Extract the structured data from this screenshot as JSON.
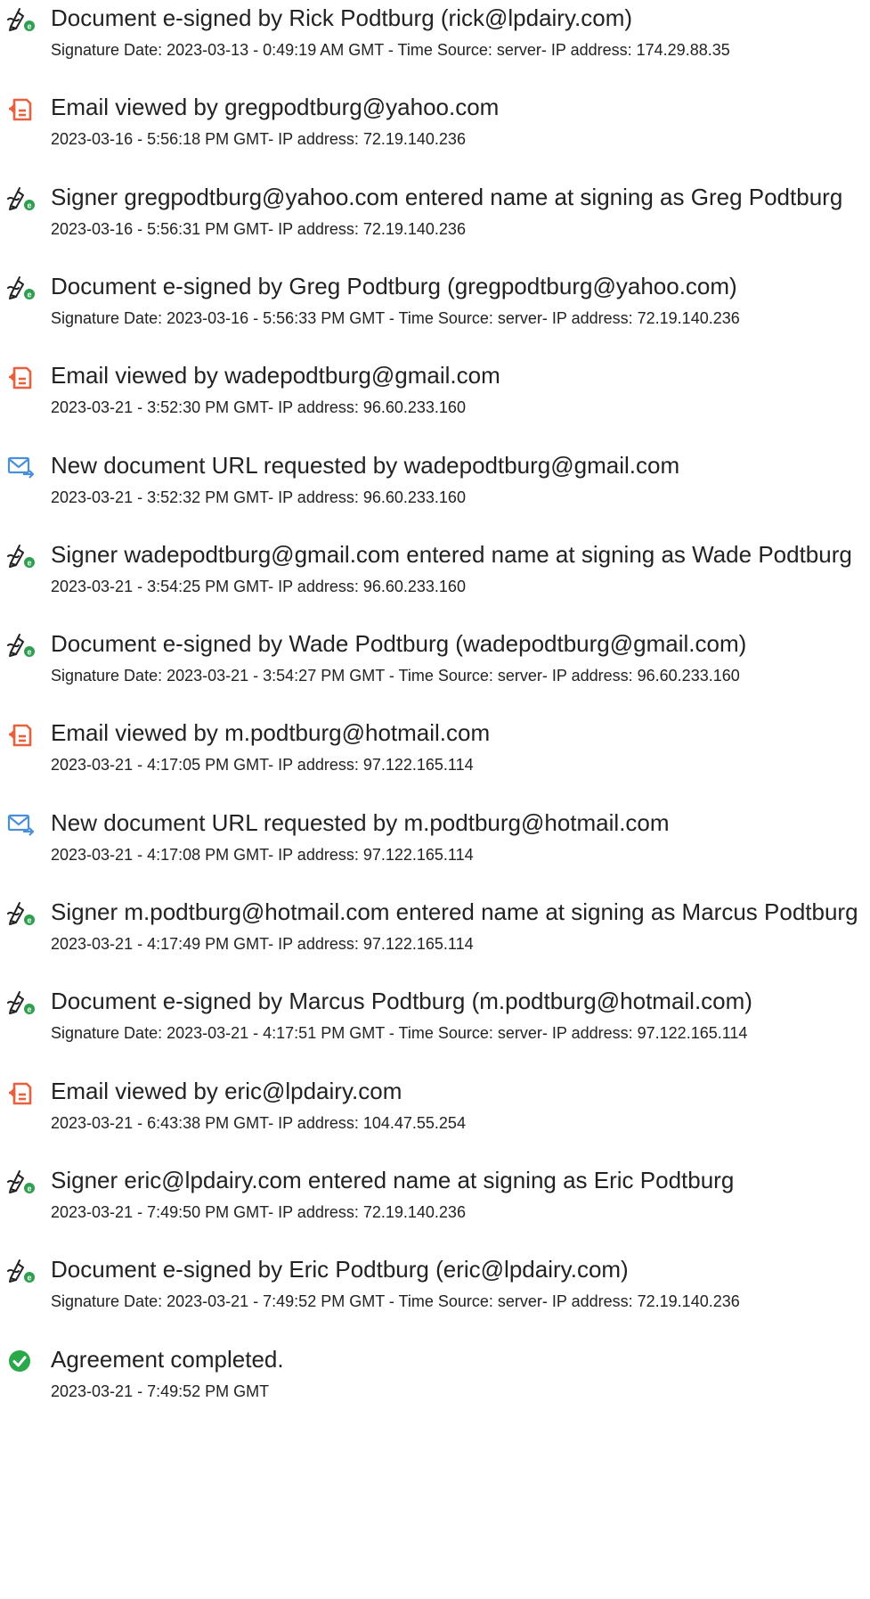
{
  "events": [
    {
      "icon": "pen-sign-icon",
      "title": "Document e-signed by Rick Podtburg (rick@lpdairy.com)",
      "detail": "Signature Date: 2023-03-13 - 0:49:19 AM GMT - Time Source: server- IP address: 174.29.88.35"
    },
    {
      "icon": "document-viewed-icon",
      "title": "Email viewed by gregpodtburg@yahoo.com",
      "detail": "2023-03-16 - 5:56:18 PM GMT- IP address: 72.19.140.236"
    },
    {
      "icon": "pen-sign-icon",
      "title": "Signer gregpodtburg@yahoo.com entered name at signing as Greg Podtburg",
      "detail": "2023-03-16 - 5:56:31 PM GMT- IP address: 72.19.140.236"
    },
    {
      "icon": "pen-sign-icon",
      "title": "Document e-signed by Greg Podtburg (gregpodtburg@yahoo.com)",
      "detail": "Signature Date: 2023-03-16 - 5:56:33 PM GMT - Time Source: server- IP address: 72.19.140.236"
    },
    {
      "icon": "document-viewed-icon",
      "title": "Email viewed by wadepodtburg@gmail.com",
      "detail": "2023-03-21 - 3:52:30 PM GMT- IP address: 96.60.233.160"
    },
    {
      "icon": "email-forward-icon",
      "title": "New document URL requested by wadepodtburg@gmail.com",
      "detail": "2023-03-21 - 3:52:32 PM GMT- IP address: 96.60.233.160"
    },
    {
      "icon": "pen-sign-icon",
      "title": "Signer wadepodtburg@gmail.com entered name at signing as Wade Podtburg",
      "detail": "2023-03-21 - 3:54:25 PM GMT- IP address: 96.60.233.160"
    },
    {
      "icon": "pen-sign-icon",
      "title": "Document e-signed by Wade Podtburg (wadepodtburg@gmail.com)",
      "detail": "Signature Date: 2023-03-21 - 3:54:27 PM GMT - Time Source: server- IP address: 96.60.233.160"
    },
    {
      "icon": "document-viewed-icon",
      "title": "Email viewed by m.podtburg@hotmail.com",
      "detail": "2023-03-21 - 4:17:05 PM GMT- IP address: 97.122.165.114"
    },
    {
      "icon": "email-forward-icon",
      "title": "New document URL requested by m.podtburg@hotmail.com",
      "detail": "2023-03-21 - 4:17:08 PM GMT- IP address: 97.122.165.114"
    },
    {
      "icon": "pen-sign-icon",
      "title": "Signer m.podtburg@hotmail.com entered name at signing as Marcus Podtburg",
      "detail": "2023-03-21 - 4:17:49 PM GMT- IP address: 97.122.165.114"
    },
    {
      "icon": "pen-sign-icon",
      "title": "Document e-signed by Marcus Podtburg (m.podtburg@hotmail.com)",
      "detail": "Signature Date: 2023-03-21 - 4:17:51 PM GMT - Time Source: server- IP address: 97.122.165.114"
    },
    {
      "icon": "document-viewed-icon",
      "title": "Email viewed by eric@lpdairy.com",
      "detail": "2023-03-21 - 6:43:38 PM GMT- IP address: 104.47.55.254"
    },
    {
      "icon": "pen-sign-icon",
      "title": "Signer eric@lpdairy.com entered name at signing as Eric Podtburg",
      "detail": "2023-03-21 - 7:49:50 PM GMT- IP address: 72.19.140.236"
    },
    {
      "icon": "pen-sign-icon",
      "title": "Document e-signed by Eric Podtburg (eric@lpdairy.com)",
      "detail": "Signature Date: 2023-03-21 - 7:49:52 PM GMT - Time Source: server- IP address: 72.19.140.236"
    },
    {
      "icon": "checkmark-circle-icon",
      "title": "Agreement completed.",
      "detail": "2023-03-21 - 7:49:52 PM GMT"
    }
  ],
  "colors": {
    "text": "#222222",
    "sign_green": "#2e9e4f",
    "viewed_orange": "#e8603c",
    "email_blue": "#4a90d9",
    "complete_green": "#2ba84a"
  }
}
